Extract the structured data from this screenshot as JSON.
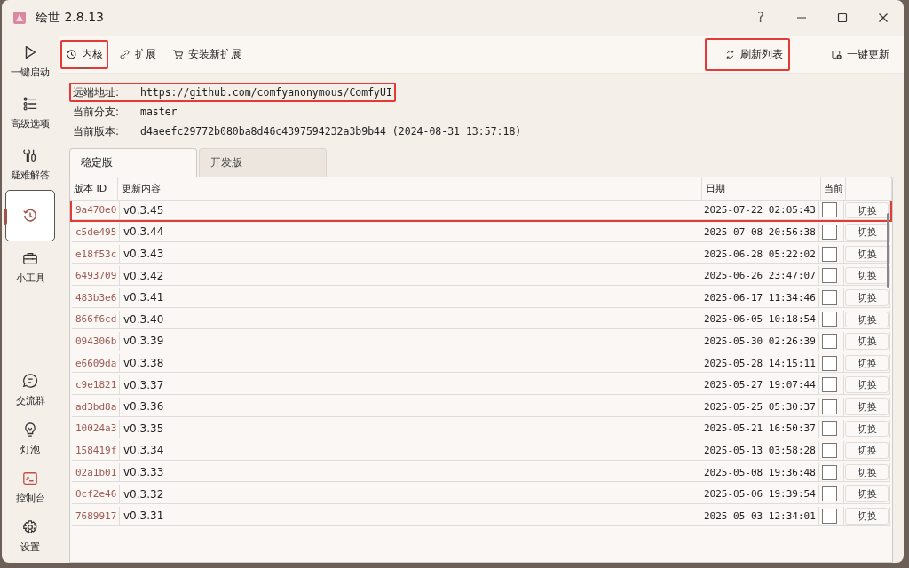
{
  "window": {
    "title": "绘世 2.8.13",
    "controls": [
      "?"
    ]
  },
  "sidebar": {
    "items": [
      {
        "kind": "play",
        "label": "一键启动",
        "selected": false
      },
      {
        "kind": "list",
        "label": "高级选项",
        "selected": false
      },
      {
        "kind": "tools",
        "label": "疑难解答",
        "selected": false
      },
      {
        "kind": "history",
        "selected": true
      },
      {
        "kind": "toolbox",
        "label": "小工具",
        "selected": false
      }
    ],
    "bottom_items": [
      {
        "kind": "chat",
        "label": "交流群"
      },
      {
        "kind": "bulb",
        "label": "灯泡"
      },
      {
        "kind": "console",
        "label": "控制台"
      },
      {
        "kind": "gear",
        "label": "设置"
      }
    ]
  },
  "toolbar": {
    "tabs": [
      {
        "kind": "history",
        "label": "内核",
        "selected": true,
        "highlighted": true
      },
      {
        "kind": "link",
        "label": "扩展",
        "selected": false,
        "highlighted": false
      },
      {
        "kind": "cart",
        "label": "安装新扩展",
        "selected": false,
        "highlighted": false
      }
    ],
    "actions": [
      {
        "kind": "refresh",
        "label": "刷新列表",
        "highlighted": true
      },
      {
        "kind": "update",
        "label": "一键更新",
        "highlighted": false
      }
    ]
  },
  "info": [
    {
      "label": "远端地址:",
      "value": "https://github.com/comfyanonymous/ComfyUI",
      "highlighted": true
    },
    {
      "label": "当前分支:",
      "value": "master",
      "highlighted": false
    },
    {
      "label": "当前版本:",
      "value": "d4aeefc29772b080ba8d46c4397594232a3b9b44 (2024-08-31 13:57:18)",
      "highlighted": false
    }
  ],
  "version_tabs": [
    {
      "label": "稳定版",
      "selected": true
    },
    {
      "label": "开发版",
      "selected": false
    }
  ],
  "table": {
    "columns": [
      "版本 ID",
      "更新内容",
      "日期",
      "当前"
    ],
    "rows": [
      {
        "id": "9a470e0",
        "content": "v0.3.45",
        "date": "2025-07-22 02:05:43",
        "current": false,
        "action": "切换",
        "highlighted": true
      },
      {
        "id": "c5de495",
        "content": "v0.3.44",
        "date": "2025-07-08 20:56:38",
        "current": false,
        "action": "切换",
        "highlighted": false
      },
      {
        "id": "e18f53c",
        "content": "v0.3.43",
        "date": "2025-06-28 05:22:02",
        "current": false,
        "action": "切换",
        "highlighted": false
      },
      {
        "id": "6493709",
        "content": "v0.3.42",
        "date": "2025-06-26 23:47:07",
        "current": false,
        "action": "切换",
        "highlighted": false
      },
      {
        "id": "483b3e6",
        "content": "v0.3.41",
        "date": "2025-06-17 11:34:46",
        "current": false,
        "action": "切换",
        "highlighted": false
      },
      {
        "id": "866f6cd",
        "content": "v0.3.40",
        "date": "2025-06-05 10:18:54",
        "current": false,
        "action": "切换",
        "highlighted": false
      },
      {
        "id": "094306b",
        "content": "v0.3.39",
        "date": "2025-05-30 02:26:39",
        "current": false,
        "action": "切换",
        "highlighted": false
      },
      {
        "id": "e6609da",
        "content": "v0.3.38",
        "date": "2025-05-28 14:15:11",
        "current": false,
        "action": "切换",
        "highlighted": false
      },
      {
        "id": "c9e1821",
        "content": "v0.3.37",
        "date": "2025-05-27 19:07:44",
        "current": false,
        "action": "切换",
        "highlighted": false
      },
      {
        "id": "ad3bd8a",
        "content": "v0.3.36",
        "date": "2025-05-25 05:30:37",
        "current": false,
        "action": "切换",
        "highlighted": false
      },
      {
        "id": "10024a3",
        "content": "v0.3.35",
        "date": "2025-05-21 16:50:37",
        "current": false,
        "action": "切换",
        "highlighted": false
      },
      {
        "id": "158419f",
        "content": "v0.3.34",
        "date": "2025-05-13 03:58:28",
        "current": false,
        "action": "切换",
        "highlighted": false
      },
      {
        "id": "02a1b01",
        "content": "v0.3.33",
        "date": "2025-05-08 19:36:48",
        "current": false,
        "action": "切换",
        "highlighted": false
      },
      {
        "id": "0cf2e46",
        "content": "v0.3.32",
        "date": "2025-05-06 19:39:54",
        "current": false,
        "action": "切换",
        "highlighted": false
      },
      {
        "id": "7689917",
        "content": "v0.3.31",
        "date": "2025-05-03 12:34:01",
        "current": false,
        "action": "切换",
        "highlighted": false
      }
    ]
  }
}
